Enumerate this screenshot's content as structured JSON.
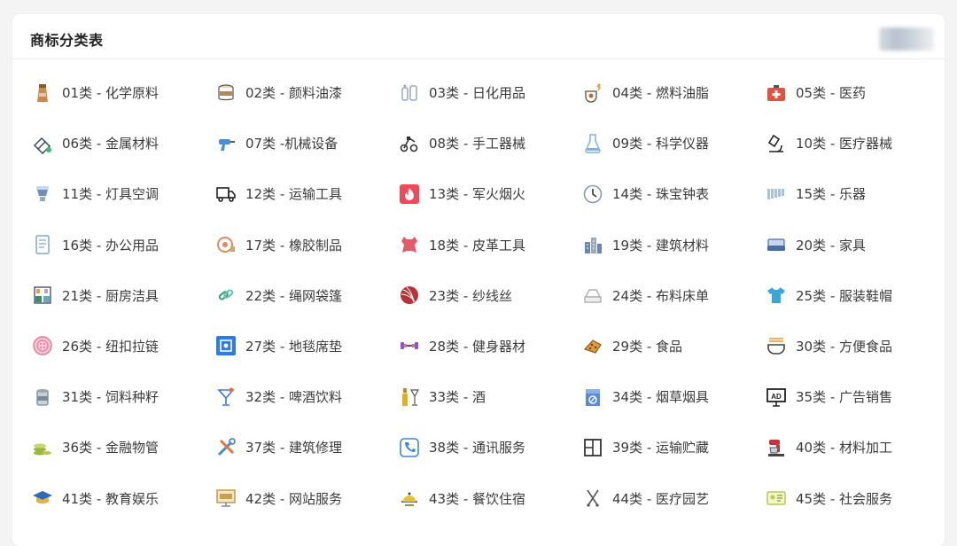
{
  "header": {
    "title": "商标分类表"
  },
  "categories": [
    {
      "label": "01类 - 化学原料",
      "icon": "chemical-bottle-icon",
      "color": "#c98a4b"
    },
    {
      "label": "02类 - 颜料油漆",
      "icon": "paint-bucket-icon",
      "color": "#b08a5a"
    },
    {
      "label": "03类 - 日化用品",
      "icon": "cosmetics-icon",
      "color": "#9aa7b5"
    },
    {
      "label": "04类 - 燃料油脂",
      "icon": "oil-lamp-icon",
      "color": "#c4683a"
    },
    {
      "label": "05类 - 医药",
      "icon": "first-aid-kit-icon",
      "color": "#e5533d"
    },
    {
      "label": "06类 - 金属材料",
      "icon": "metal-bars-icon",
      "color": "#3a4a5c"
    },
    {
      "label": "07类 -机械设备",
      "icon": "drill-icon",
      "color": "#4a90d9"
    },
    {
      "label": "08类 - 手工器械",
      "icon": "hand-tools-icon",
      "color": "#333333"
    },
    {
      "label": "09类 - 科学仪器",
      "icon": "flask-icon",
      "color": "#7fb3e0"
    },
    {
      "label": "10类 - 医疗器械",
      "icon": "microscope-icon",
      "color": "#222222"
    },
    {
      "label": "11类 - 灯具空调",
      "icon": "lamp-icon",
      "color": "#6f8fb8"
    },
    {
      "label": "12类 - 运输工具",
      "icon": "truck-icon",
      "color": "#222222"
    },
    {
      "label": "13类 - 军火烟火",
      "icon": "fire-icon",
      "color": "#ee4a5a"
    },
    {
      "label": "14类 - 珠宝钟表",
      "icon": "clock-icon",
      "color": "#8a98b0"
    },
    {
      "label": "15类 - 乐器",
      "icon": "xylophone-icon",
      "color": "#a8c2d8"
    },
    {
      "label": "16类 - 办公用品",
      "icon": "document-icon",
      "color": "#7fa8d8"
    },
    {
      "label": "17类 - 橡胶制品",
      "icon": "tape-roll-icon",
      "color": "#e48a5a"
    },
    {
      "label": "18类 - 皮革工具",
      "icon": "leather-hide-icon",
      "color": "#e65a6a"
    },
    {
      "label": "19类 - 建筑材料",
      "icon": "buildings-icon",
      "color": "#6a86b0"
    },
    {
      "label": "20类 - 家具",
      "icon": "sofa-icon",
      "color": "#4a6fa8"
    },
    {
      "label": "21类 - 厨房洁具",
      "icon": "kitchen-shelf-icon",
      "color": "#3b8a6a"
    },
    {
      "label": "22类 - 绳网袋篷",
      "icon": "chain-link-icon",
      "color": "#3a9a7a"
    },
    {
      "label": "23类 - 纱线丝",
      "icon": "yarn-ball-icon",
      "color": "#b8323a"
    },
    {
      "label": "24类 - 布料床单",
      "icon": "folded-cloth-icon",
      "color": "#b0b0b0"
    },
    {
      "label": "25类 - 服装鞋帽",
      "icon": "tshirt-icon",
      "color": "#3aa6d8"
    },
    {
      "label": "26类 - 纽扣拉链",
      "icon": "button-icon",
      "color": "#e6779a"
    },
    {
      "label": "27类 - 地毯席垫",
      "icon": "rug-icon",
      "color": "#2f7be0"
    },
    {
      "label": "28类 - 健身器材",
      "icon": "dumbbell-icon",
      "color": "#8a5ac8"
    },
    {
      "label": "29类 - 食品",
      "icon": "cookie-icon",
      "color": "#e09a3a"
    },
    {
      "label": "30类 - 方便食品",
      "icon": "noodle-bowl-icon",
      "color": "#444444"
    },
    {
      "label": "31类 - 饲料种籽",
      "icon": "seed-can-icon",
      "color": "#7a8a98"
    },
    {
      "label": "32类 - 啤酒饮料",
      "icon": "cocktail-icon",
      "color": "#3a7ad8"
    },
    {
      "label": "33类 - 酒",
      "icon": "wine-bottle-icon",
      "color": "#e0b020"
    },
    {
      "label": "34类 - 烟草烟具",
      "icon": "no-smoking-box-icon",
      "color": "#5a8ad8"
    },
    {
      "label": "35类 - 广告销售",
      "icon": "ad-board-icon",
      "color": "#222222"
    },
    {
      "label": "36类 - 金融物管",
      "icon": "coins-icon",
      "color": "#9ab83a"
    },
    {
      "label": "37类 - 建筑修理",
      "icon": "repair-tools-icon",
      "color": "#e07a3a"
    },
    {
      "label": "38类 - 通讯服务",
      "icon": "phone-icon",
      "color": "#3a8ad8"
    },
    {
      "label": "39类 - 运输贮藏",
      "icon": "warehouse-icon",
      "color": "#333333"
    },
    {
      "label": "40类 - 材料加工",
      "icon": "mixer-icon",
      "color": "#c8323a"
    },
    {
      "label": "41类 - 教育娱乐",
      "icon": "graduation-cap-icon",
      "color": "#2f6ab8"
    },
    {
      "label": "42类 - 网站服务",
      "icon": "monitor-icon",
      "color": "#c8a050"
    },
    {
      "label": "43类 - 餐饮住宿",
      "icon": "food-platter-icon",
      "color": "#8a9a3a"
    },
    {
      "label": "44类 - 医疗园艺",
      "icon": "scissors-icon",
      "color": "#555555"
    },
    {
      "label": "45类 - 社会服务",
      "icon": "id-card-icon",
      "color": "#b8c85a"
    }
  ]
}
